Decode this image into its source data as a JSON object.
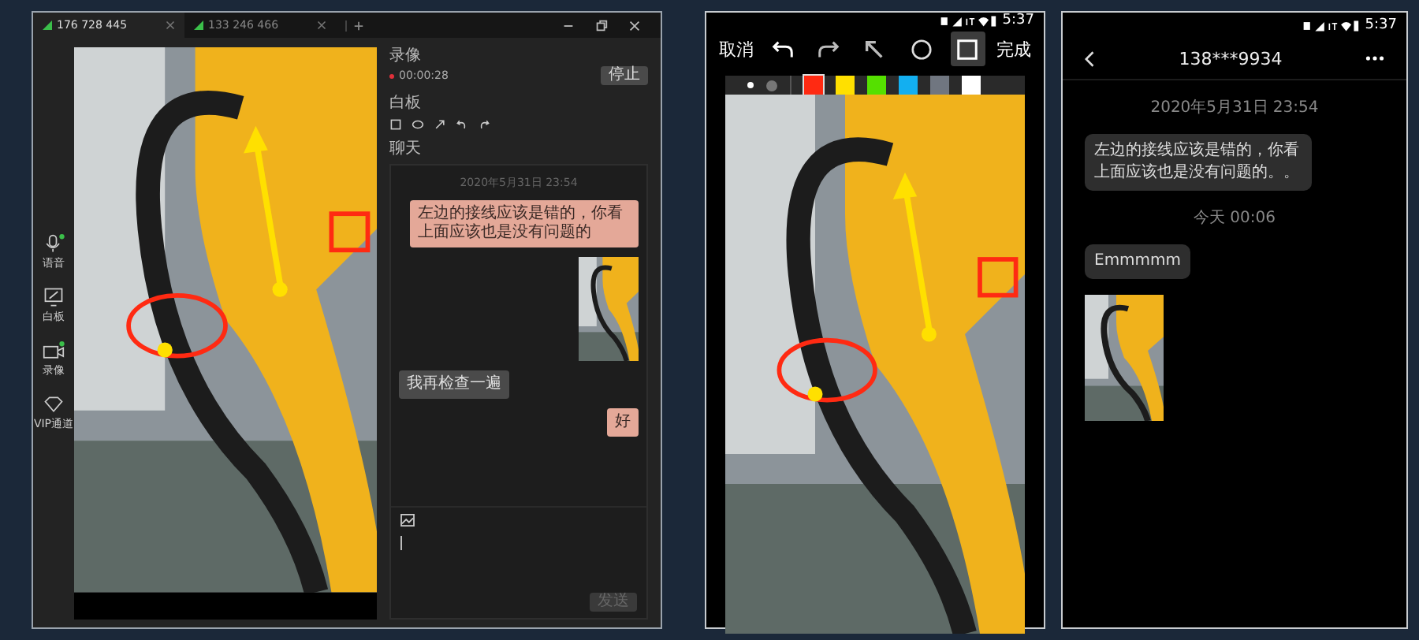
{
  "desktop": {
    "tabs": [
      {
        "label": "176 728 445",
        "selected": true
      },
      {
        "label": "133 246 466",
        "selected": false
      }
    ],
    "sidebar": [
      {
        "kind": "mic",
        "label": "语音",
        "active": true
      },
      {
        "kind": "board",
        "label": "白板",
        "active": false
      },
      {
        "kind": "camera",
        "label": "录像",
        "active": true
      },
      {
        "kind": "vip",
        "label": "VIP通道",
        "active": false
      }
    ],
    "recording": {
      "title": "录像",
      "time": "00:00:28",
      "stop_button": "停止"
    },
    "whiteboard": {
      "title": "白板",
      "tools": [
        {
          "kind": "rect"
        },
        {
          "kind": "ellipse"
        },
        {
          "kind": "arrow"
        },
        {
          "kind": "undo"
        },
        {
          "kind": "redo"
        }
      ]
    },
    "chat": {
      "title": "聊天",
      "messages": [
        {
          "kind": "time",
          "text": "2020年5月31日 23:54"
        },
        {
          "kind": "sent_text",
          "text": "左边的接线应该是错的，你看上面应该也是没有问题的"
        },
        {
          "kind": "sent_image"
        },
        {
          "kind": "received_text",
          "text": "我再检查一遍"
        },
        {
          "kind": "sent_text",
          "text": "好"
        }
      ],
      "send_button": "发送"
    }
  },
  "editor": {
    "status_time": "5:37",
    "cancel": "取消",
    "done": "完成",
    "tools": [
      {
        "kind": "undo",
        "selected": false
      },
      {
        "kind": "redo",
        "selected": false
      },
      {
        "kind": "arrow",
        "selected": false
      },
      {
        "kind": "circle",
        "selected": false
      },
      {
        "kind": "rect",
        "selected": true
      }
    ],
    "sizes": [
      {
        "selected": true
      },
      {
        "selected": false
      }
    ],
    "colors": [
      {
        "color": "#ff2a12",
        "selected": true
      },
      {
        "color": "#ffe000",
        "selected": false
      },
      {
        "color": "#55e000",
        "selected": false
      },
      {
        "color": "#13aff0",
        "selected": false
      },
      {
        "color": "#707680",
        "selected": false
      },
      {
        "color": "#ffffff",
        "selected": false
      }
    ]
  },
  "phone_chat": {
    "status_time": "5:37",
    "title": "138***9934",
    "messages": [
      {
        "kind": "time",
        "text": "2020年5月31日 23:54"
      },
      {
        "kind": "received_text",
        "text": "左边的接线应该是错的，你看上面应该也是没有问题的。。"
      },
      {
        "kind": "time",
        "text": "今天 00:06"
      },
      {
        "kind": "received_text",
        "text": "Emmmmm"
      },
      {
        "kind": "received_image"
      }
    ]
  }
}
